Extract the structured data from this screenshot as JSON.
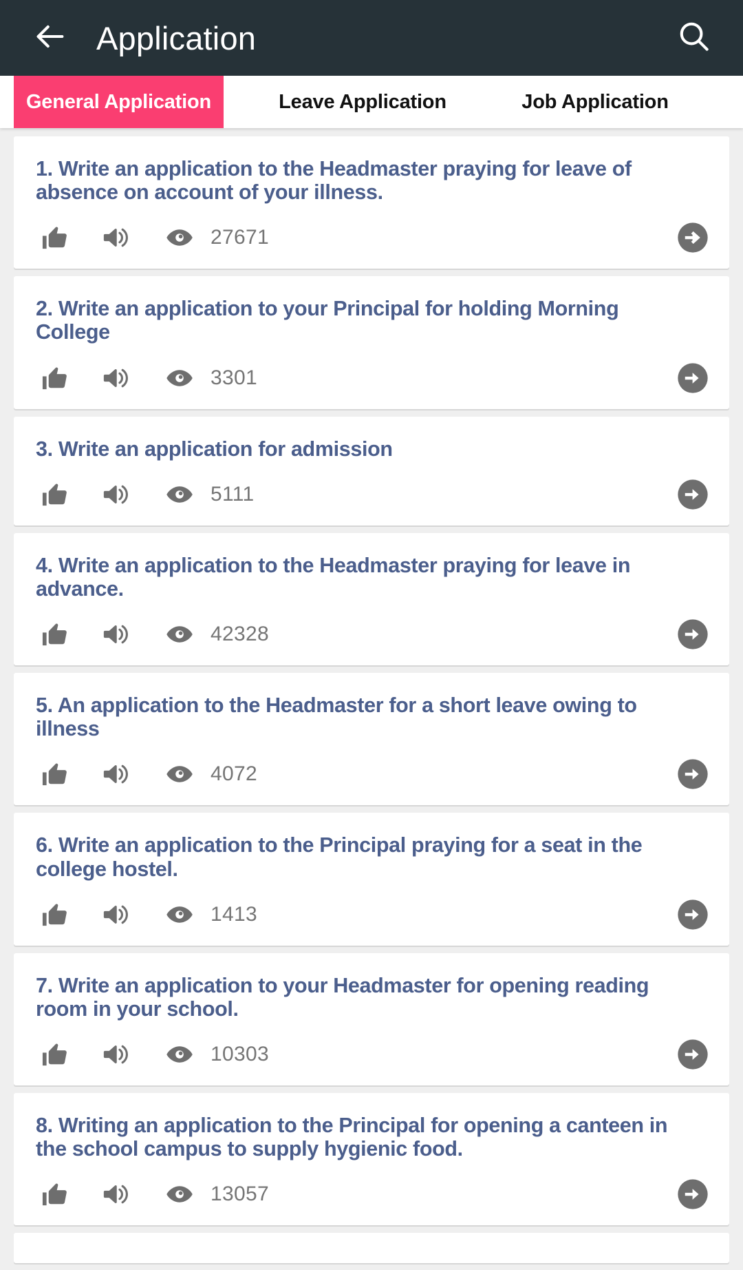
{
  "header": {
    "title": "Application",
    "back_icon": "back-arrow-icon",
    "search_icon": "search-icon",
    "background_color": "#263238",
    "text_color": "#ffffff"
  },
  "tabs": {
    "active_index": 0,
    "active_color": "#fa3e71",
    "active_text_color": "#ffffff",
    "inactive_text_color": "#111111",
    "items": [
      {
        "label": "General Application"
      },
      {
        "label": "Leave Application"
      },
      {
        "label": "Job Application"
      }
    ]
  },
  "card_icons": {
    "like": "thumbs-up-icon",
    "speak": "speaker-volume-icon",
    "views": "eye-icon",
    "open": "arrow-right-circle-icon"
  },
  "theme": {
    "page_background": "#efefef",
    "card_background": "#ffffff",
    "card_title_color": "#4b5e8c",
    "meta_icon_color": "#6e6e6e",
    "views_text_color": "#757575"
  },
  "list": {
    "items": [
      {
        "title": "1. Write an application to the Headmaster praying for leave of absence on account of your illness.",
        "views": "27671"
      },
      {
        "title": "2. Write an application to your Principal for holding Morning College",
        "views": "3301"
      },
      {
        "title": "3. Write an application for admission",
        "views": "5111"
      },
      {
        "title": "4. Write an application to the Headmaster praying for leave in advance.",
        "views": "42328"
      },
      {
        "title": "5. An application to the Headmaster for a short leave owing to illness",
        "views": "4072"
      },
      {
        "title": "6. Write an application to the Principal praying for a seat in the college hostel.",
        "views": "1413"
      },
      {
        "title": "7. Write an application to your Headmaster for opening reading room in your school.",
        "views": "10303"
      },
      {
        "title": "8. Writing an application to the Principal for opening a canteen in the school campus to supply hygienic food.",
        "views": "13057"
      },
      {
        "title": "",
        "views": ""
      }
    ]
  }
}
